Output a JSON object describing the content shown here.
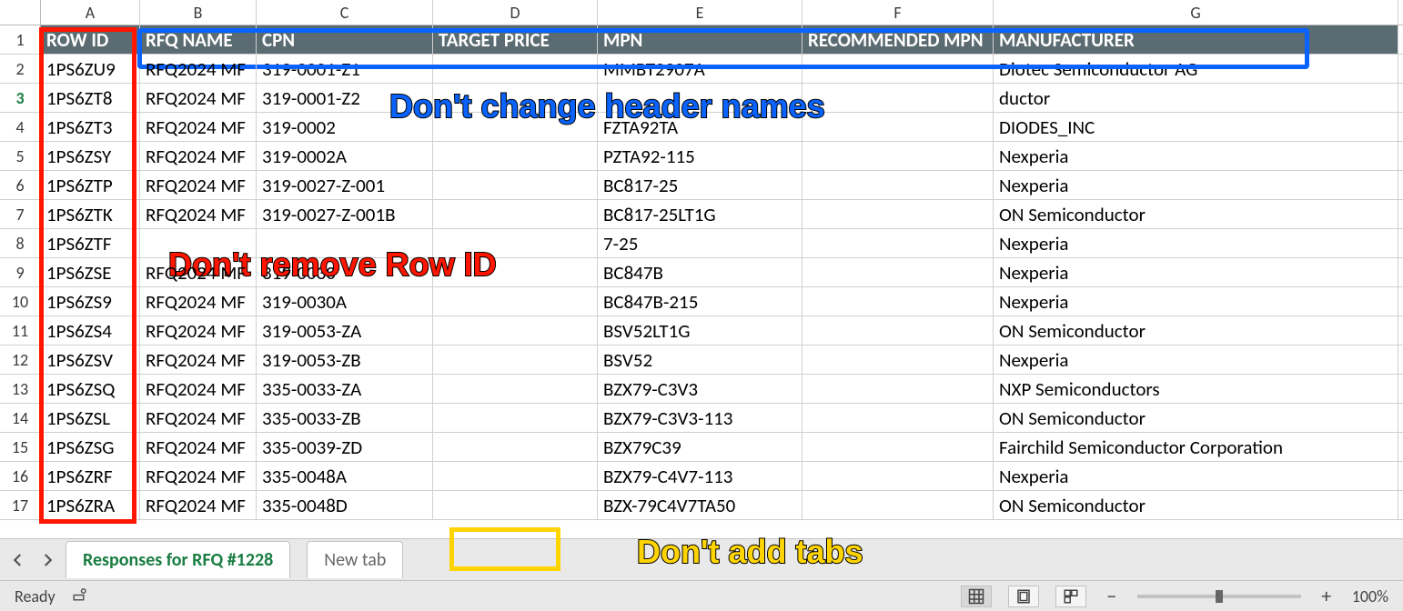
{
  "columns_letters": [
    "A",
    "B",
    "C",
    "D",
    "E",
    "F",
    "G"
  ],
  "headers": {
    "A": "ROW ID",
    "B": "RFQ NAME",
    "C": "CPN",
    "D": "TARGET PRICE",
    "E": "MPN",
    "F": "RECOMMENDED MPN",
    "G": "MANUFACTURER"
  },
  "header_display": {
    "F": "RECOMMENDED MPN"
  },
  "rows": [
    {
      "n": 2,
      "A": "1PS6ZU9",
      "B": "RFQ2024 MF",
      "C": "319-0001-Z1",
      "D": "",
      "E": "MMBT2907A",
      "F": "",
      "G": "Diotec Semiconductor AG"
    },
    {
      "n": 3,
      "A": "1PS6ZT8",
      "B": "RFQ2024 MF",
      "C": "319-0001-Z2",
      "D": "",
      "E": "",
      "F": "",
      "G": "ductor"
    },
    {
      "n": 4,
      "A": "1PS6ZT3",
      "B": "RFQ2024 MF",
      "C": "319-0002",
      "D": "",
      "E": "FZTA92TA",
      "F": "",
      "G": "DIODES_INC"
    },
    {
      "n": 5,
      "A": "1PS6ZSY",
      "B": "RFQ2024 MF",
      "C": "319-0002A",
      "D": "",
      "E": "PZTA92-115",
      "F": "",
      "G": "Nexperia"
    },
    {
      "n": 6,
      "A": "1PS6ZTP",
      "B": "RFQ2024 MF",
      "C": "319-0027-Z-001",
      "D": "",
      "E": "BC817-25",
      "F": "",
      "G": "Nexperia"
    },
    {
      "n": 7,
      "A": "1PS6ZTK",
      "B": "RFQ2024 MF",
      "C": "319-0027-Z-001B",
      "D": "",
      "E": "BC817-25LT1G",
      "F": "",
      "G": "ON Semiconductor"
    },
    {
      "n": 8,
      "A": "1PS6ZTF",
      "B": "",
      "C": "",
      "D": "",
      "E": "7-25",
      "F": "",
      "G": "Nexperia"
    },
    {
      "n": 9,
      "A": "1PS6ZSE",
      "B": "RFQ2024 MF",
      "C": "319-0030",
      "D": "",
      "E": "BC847B",
      "F": "",
      "G": "Nexperia"
    },
    {
      "n": 10,
      "A": "1PS6ZS9",
      "B": "RFQ2024 MF",
      "C": "319-0030A",
      "D": "",
      "E": "BC847B-215",
      "F": "",
      "G": "Nexperia"
    },
    {
      "n": 11,
      "A": "1PS6ZS4",
      "B": "RFQ2024 MF",
      "C": "319-0053-ZA",
      "D": "",
      "E": "BSV52LT1G",
      "F": "",
      "G": "ON Semiconductor"
    },
    {
      "n": 12,
      "A": "1PS6ZSV",
      "B": "RFQ2024 MF",
      "C": "319-0053-ZB",
      "D": "",
      "E": "BSV52",
      "F": "",
      "G": "Nexperia"
    },
    {
      "n": 13,
      "A": "1PS6ZSQ",
      "B": "RFQ2024 MF",
      "C": "335-0033-ZA",
      "D": "",
      "E": "BZX79-C3V3",
      "F": "",
      "G": "NXP Semiconductors"
    },
    {
      "n": 14,
      "A": "1PS6ZSL",
      "B": "RFQ2024 MF",
      "C": "335-0033-ZB",
      "D": "",
      "E": "BZX79-C3V3-113",
      "F": "",
      "G": "ON Semiconductor"
    },
    {
      "n": 15,
      "A": "1PS6ZSG",
      "B": "RFQ2024 MF",
      "C": "335-0039-ZD",
      "D": "",
      "E": "BZX79C39",
      "F": "",
      "G": "Fairchild Semiconductor Corporation"
    },
    {
      "n": 16,
      "A": "1PS6ZRF",
      "B": "RFQ2024 MF",
      "C": "335-0048A",
      "D": "",
      "E": "BZX79-C4V7-113",
      "F": "",
      "G": "Nexperia"
    },
    {
      "n": 17,
      "A": "1PS6ZRA",
      "B": "RFQ2024 MF",
      "C": "335-0048D",
      "D": "",
      "E": "BZX-79C4V7TA50",
      "F": "",
      "G": "ON Semiconductor"
    }
  ],
  "tabs": {
    "active": "Responses for RFQ #1228",
    "new": "New tab"
  },
  "status": {
    "ready": "Ready",
    "zoom": "100%"
  },
  "annotations": {
    "header_note": "Don't change header names",
    "rowid_note": "Don't remove Row ID",
    "tabs_note": "Don't add tabs"
  }
}
